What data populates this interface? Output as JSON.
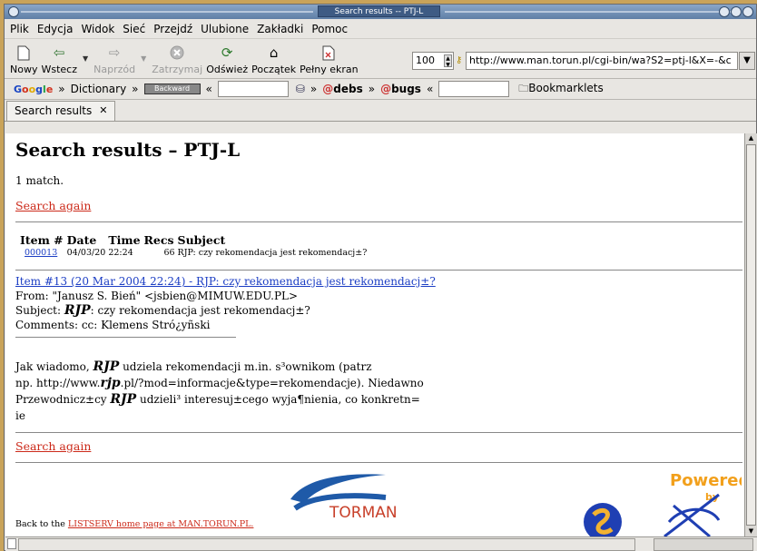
{
  "window": {
    "title": "Search results -- PTJ-L"
  },
  "menubar": {
    "items": [
      "Plik",
      "Edycja",
      "Widok",
      "Sieć",
      "Przejdź",
      "Ulubione",
      "Zakładki",
      "Pomoc"
    ]
  },
  "toolbar": {
    "new_label": "Nowy",
    "back_label": "Wstecz",
    "forward_label": "Naprzód",
    "stop_label": "Zatrzymaj",
    "reload_label": "Odśwież",
    "home_label": "Początek",
    "fullscreen_label": "Pełny ekran",
    "zoom_value": "100",
    "url": "http://www.man.torun.pl/cgi-bin/wa?S2=ptj-l&X=-&c"
  },
  "bookmarks": {
    "google_label": "Google",
    "dictionary_label": "Dictionary",
    "box_label": "Backward",
    "debs_label": "debs",
    "bugs_label": "bugs",
    "bookmarklets_label": "Bookmarklets"
  },
  "tab": {
    "label": "Search results"
  },
  "page": {
    "heading": "Search results – PTJ-L",
    "match_count": "1 match.",
    "search_again": "Search again",
    "table": {
      "headers": [
        "Item #",
        "Date",
        "Time",
        "Recs",
        "Subject"
      ],
      "rows": [
        {
          "item": "000013",
          "date": "04/03/20",
          "time": "22:24",
          "recs": "66",
          "subject": "RJP: czy rekomendacja jest rekomendacj±?"
        }
      ]
    },
    "message": {
      "link": "Item #13 (20 Mar 2004 22:24) - RJP: czy rekomendacja jest rekomendacj±?",
      "from": "From: \"Janusz S. Bień\" <jsbien@MIMUW.EDU.PL>",
      "subject_prefix": "Subject: ",
      "subject_rjp": "RJP",
      "subject_rest": ": czy rekomendacja jest rekomendacj±?",
      "comments": "Comments: cc: Klemens Stró¿yñski",
      "body_l1_a": "Jak wiadomo, ",
      "body_l1_rjp": "RJP",
      "body_l1_b": " udziela rekomendacji m.in. s³ownikom (patrz",
      "body_l2_a": "np. http://www.",
      "body_l2_rjp": "rjp",
      "body_l2_b": ".pl/?mod=informacje&type=rekomendacje). Niedawno",
      "body_l3_a": "Przewodnicz±cy ",
      "body_l3_rjp": "RJP",
      "body_l3_b": " udzieli³ interesuj±cego wyja¶nienia, co konkretn=",
      "body_l4": "ie"
    },
    "footer_prefix": "Back to the ",
    "footer_link": "LISTSERV home page at MAN.TORUN.PL.",
    "torman_logo_text": "TORMAN",
    "powered_text": "Powered",
    "powered_by": "by"
  },
  "colors": {
    "link_red": "#cc2a1a",
    "link_blue": "#1c3ec4"
  }
}
